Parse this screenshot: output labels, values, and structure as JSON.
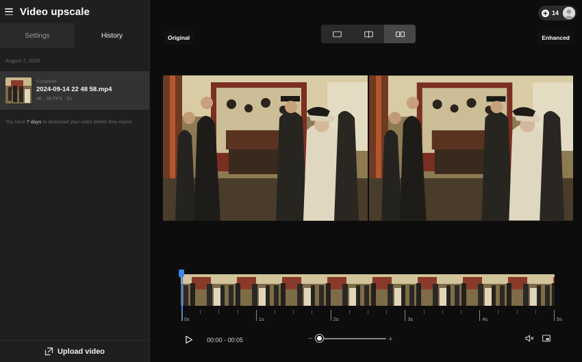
{
  "sidebar": {
    "title": "Video upscale",
    "tabs": [
      {
        "label": "Settings",
        "active": false
      },
      {
        "label": "History",
        "active": true
      }
    ],
    "date_group": "August 7, 2025",
    "item": {
      "status": "Complete",
      "filename": "2024-09-14 22 48 58.mp4",
      "meta": "4K · 30 FPS · 5s"
    },
    "expire_note": {
      "prefix": "You have ",
      "bold": "7 days",
      "suffix": " to download your video before they expire."
    },
    "upload_label": "Upload video"
  },
  "header": {
    "credits": "14"
  },
  "view_modes": [
    {
      "icon": "single-view-icon",
      "active": false
    },
    {
      "icon": "split-view-icon",
      "active": false
    },
    {
      "icon": "side-by-side-icon",
      "active": true
    }
  ],
  "labels": {
    "original": "Original",
    "enhanced": "Enhanced"
  },
  "timeline": {
    "ticks": [
      "0s",
      "1s",
      "2s",
      "3s",
      "4s",
      "5s"
    ],
    "frame_count": 8
  },
  "player": {
    "time": "00:00 - 00:05",
    "zoom_minus": "−",
    "zoom_plus": "+",
    "zoom_level": 0
  },
  "colors": {
    "accent": "#3b87e8",
    "sidebar_bg": "#1f1f1f",
    "main_bg": "#0d0d0d"
  }
}
